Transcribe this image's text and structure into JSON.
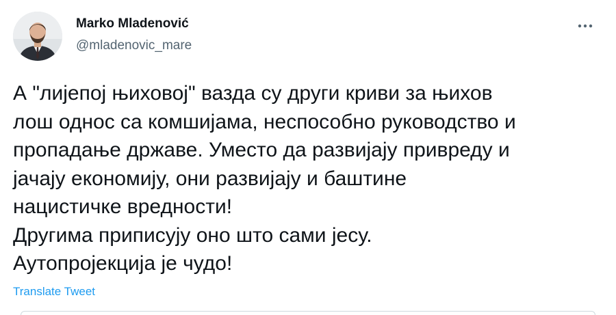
{
  "author": {
    "name": "Marko Mladenović",
    "handle": "@mladenovic_mare",
    "avatar_icon": "person-avatar-icon"
  },
  "menu": {
    "more_icon": "more-horizontal-icon"
  },
  "tweet": {
    "lines": [
      "А \"лијепој њиховој\" вазда су други криви за њихов",
      "лош однос са комшијама, неспособно руководство и",
      "пропадање државе. Уместо да развијају привреду и",
      "јачају економију, они развијају и баштине",
      "нацистичке вредности!",
      "Другима приписују оно што сами јесу.",
      "Аутопројекција је чудо!"
    ]
  },
  "actions": {
    "translate_label": "Translate Tweet"
  },
  "colors": {
    "text": "#0f1419",
    "secondary": "#536471",
    "link": "#1d9bf0"
  }
}
